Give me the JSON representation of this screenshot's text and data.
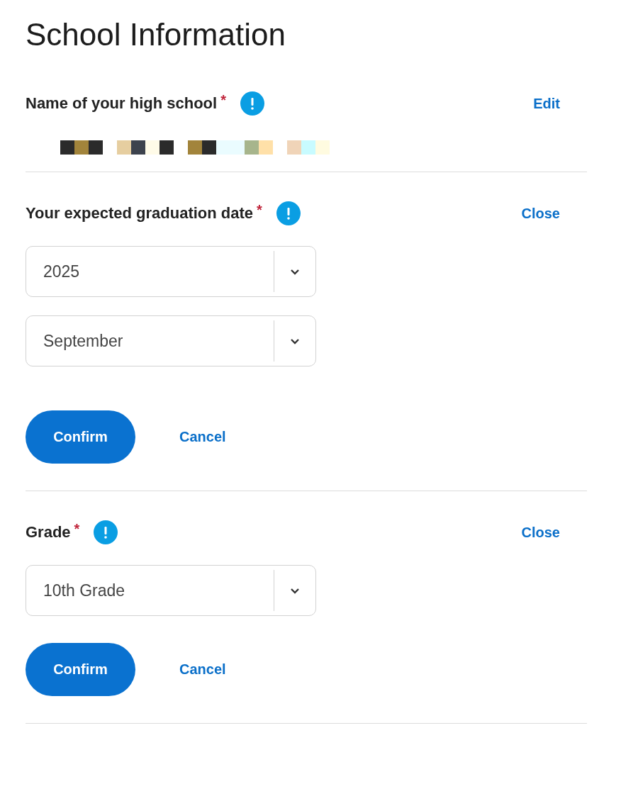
{
  "title": "School Information",
  "sections": [
    {
      "kind": "display",
      "label": "Name of your high school",
      "required_mark": "*",
      "action": "Edit"
    },
    {
      "kind": "select_group",
      "label": "Your expected graduation date",
      "required_mark": "*",
      "action": "Close",
      "selects": [
        "2025",
        "September"
      ],
      "confirm": "Confirm",
      "cancel": "Cancel"
    },
    {
      "kind": "select_group",
      "label": "Grade",
      "required_mark": "*",
      "action": "Close",
      "selects": [
        "10th Grade"
      ],
      "confirm": "Confirm",
      "cancel": "Cancel"
    }
  ]
}
